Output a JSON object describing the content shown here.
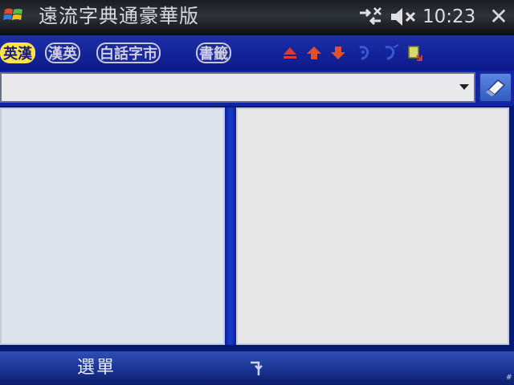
{
  "titlebar": {
    "app_title": "遠流字典通豪華版",
    "clock": "10:23",
    "close_glyph": "✕",
    "icons": [
      "windows-start-icon",
      "connectivity-icon",
      "volume-muted-icon"
    ]
  },
  "toolbar": {
    "tabs": [
      {
        "label": "英漢",
        "active": true
      },
      {
        "label": "漢英",
        "active": false
      },
      {
        "label": "白話字市",
        "active": false
      },
      {
        "label": "書籤",
        "active": false
      }
    ],
    "icons": [
      "eject-icon",
      "arrow-up-icon",
      "arrow-down-icon",
      "speaker-icon",
      "pronounce-icon",
      "dictionary-icon"
    ]
  },
  "search": {
    "value": "",
    "placeholder": ""
  },
  "softkeys": {
    "left_label": "選單",
    "center_icon": "keyboard-icon"
  },
  "colors": {
    "toolbar": "#0c1a8a",
    "active_tab": "#ffe34a",
    "left_panel": "#dde3ec",
    "right_panel": "#e7e7e8"
  },
  "corner_mark": "#"
}
